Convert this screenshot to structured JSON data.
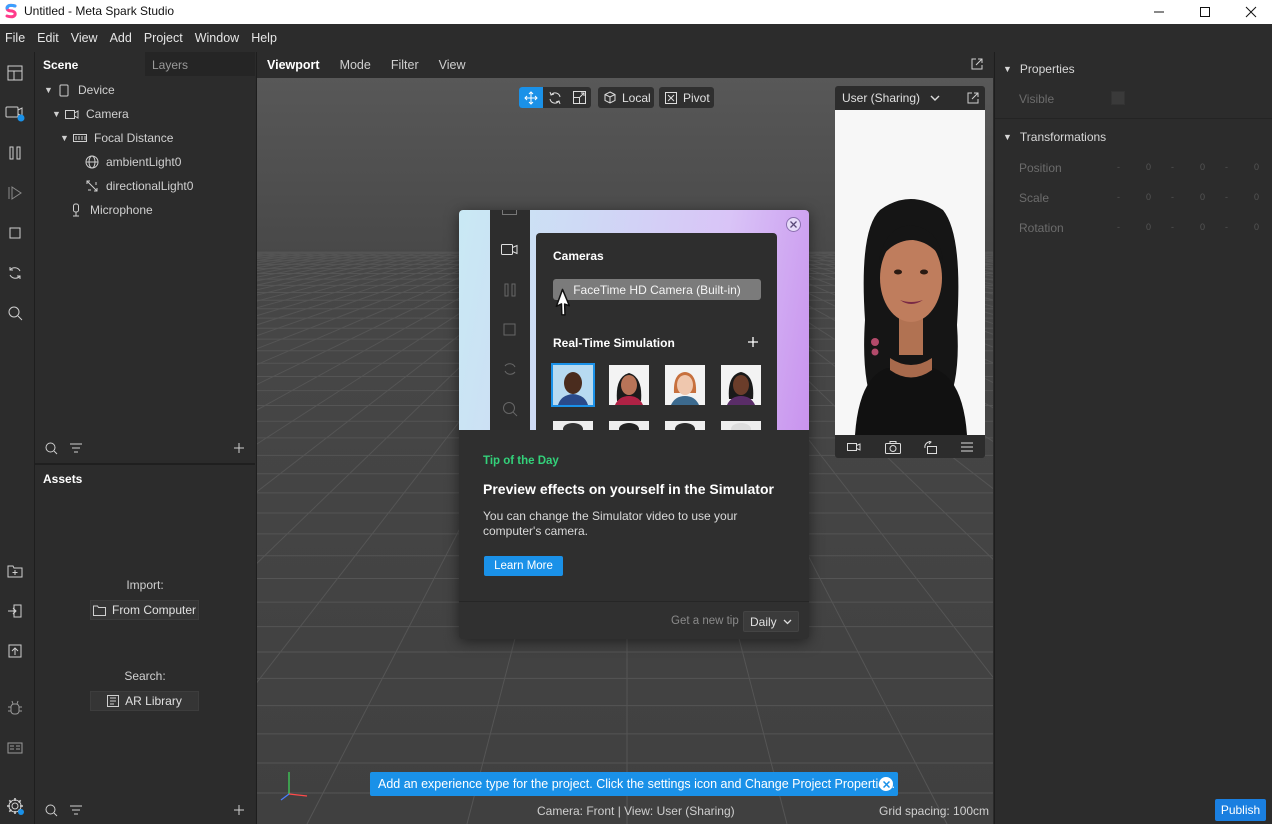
{
  "window": {
    "title": "Untitled - Meta Spark Studio"
  },
  "menu": [
    "File",
    "Edit",
    "View",
    "Add",
    "Project",
    "Window",
    "Help"
  ],
  "scene_panel": {
    "tabs": [
      "Scene",
      "Layers"
    ],
    "tree": [
      {
        "label": "Device",
        "icon": "device-icon",
        "expanded": true
      },
      {
        "label": "Camera",
        "icon": "camera-icon",
        "expanded": true
      },
      {
        "label": "Focal Distance",
        "icon": "focal-distance-icon",
        "expanded": true
      },
      {
        "label": "ambientLight0",
        "icon": "ambient-light-icon"
      },
      {
        "label": "directionalLight0",
        "icon": "directional-light-icon"
      },
      {
        "label": "Microphone",
        "icon": "microphone-icon"
      }
    ]
  },
  "assets_panel": {
    "title": "Assets",
    "import_label": "Import:",
    "import_button": "From Computer",
    "search_label": "Search:",
    "search_button": "AR Library"
  },
  "viewport": {
    "tabs": [
      "Viewport",
      "Mode",
      "Filter",
      "View"
    ],
    "toolbar": {
      "local_label": "Local",
      "pivot_label": "Pivot"
    },
    "status": "Camera: Front | View: User (Sharing)",
    "grid_spacing": "Grid spacing: 100cm"
  },
  "simulator": {
    "view_select": "User (Sharing)"
  },
  "properties_panel": {
    "title": "Properties",
    "visible_label": "Visible",
    "transformations_title": "Transformations",
    "rows": [
      "Position",
      "Scale",
      "Rotation"
    ]
  },
  "tip_dialog": {
    "cameras_title": "Cameras",
    "camera_selected": "FaceTime HD Camera (Built-in)",
    "realtime_title": "Real-Time Simulation",
    "eyebrow": "Tip of the Day",
    "heading": "Preview effects on yourself in the Simulator",
    "body": "You can change the Simulator video to use your computer's camera.",
    "learn_more": "Learn More",
    "new_tip_label": "Get a new tip",
    "frequency": "Daily"
  },
  "notification": {
    "text": "Add an experience type for the project. Click the settings icon and Change Project Properties."
  },
  "publish_label": "Publish",
  "colors": {
    "accent": "#1a91e8",
    "tip_eyebrow": "#33d17a",
    "panel_bg": "#2c2c2c",
    "viewport_bg": "#4a4a4a"
  }
}
